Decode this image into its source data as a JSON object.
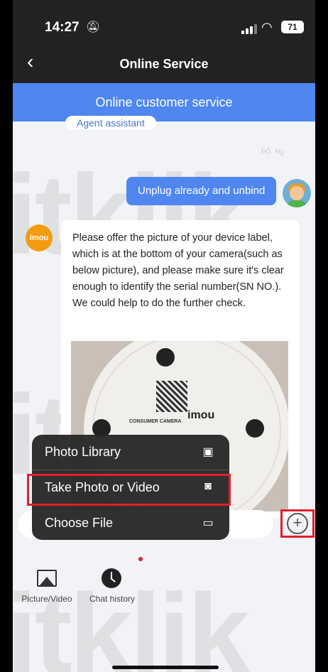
{
  "status": {
    "time": "14:27",
    "battery": "71"
  },
  "nav": {
    "title": "Online Service"
  },
  "service_header": "Online customer service",
  "agent_pill": "Agent assistant",
  "user_message": "Unplug already and unbind",
  "bot": {
    "avatar_label": "imou",
    "message": "Please offer the picture of your device label, which is at the bottom of your camera(such as below picture), and please make sure it's clear enough to identify the serial number(SN NO.). We could help to do the further check.",
    "photo_label": "CONSUMER CAMERA",
    "photo_brand": "imou"
  },
  "menu": {
    "items": [
      {
        "label": "Photo Library",
        "icon": "photo-library-icon"
      },
      {
        "label": "Take Photo or Video",
        "icon": "camera-icon"
      },
      {
        "label": "Choose File",
        "icon": "folder-icon"
      }
    ]
  },
  "toolbar": {
    "picture_video": "Picture/Video",
    "chat_history": "Chat history"
  },
  "colors": {
    "accent": "#4f86f0",
    "highlight": "#e0202a",
    "dark": "#222222"
  },
  "watermark": "itklik"
}
